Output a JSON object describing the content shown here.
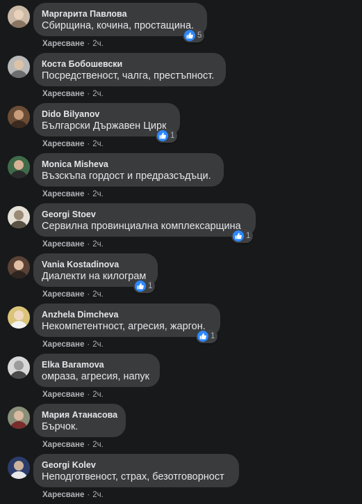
{
  "colors": {
    "background": "#18191a",
    "bubble": "#3a3b3c",
    "text": "#e4e6eb",
    "secondary_text": "#b0b3b8",
    "like_blue": "#2d88ff"
  },
  "comments": [
    {
      "author": "Маргарита Павлова",
      "text": "Сбирщина, кочина, простащина.",
      "like_label": "Харесване",
      "time": "2ч.",
      "reactions": "5",
      "reaction_icon": "like-icon"
    },
    {
      "author": "Коста Бобошевски",
      "text": "Посредственост, чалга, престъпност.",
      "like_label": "Харесване",
      "time": "2ч."
    },
    {
      "author": "Dido Bilyanov",
      "text": "Български Държавен Цирк",
      "like_label": "Харесване",
      "time": "2ч.",
      "reactions": "1",
      "reaction_icon": "like-icon"
    },
    {
      "author": "Monica Misheva",
      "text": "Възскъпа гордост и предразсъдъци.",
      "like_label": "Харесване",
      "time": "2ч."
    },
    {
      "author": "Georgi Stoev",
      "text": "Сервилна провинциална комплексарщина",
      "like_label": "Харесване",
      "time": "2ч.",
      "reactions": "1",
      "reaction_icon": "like-icon"
    },
    {
      "author": "Vania Kostadinova",
      "text": "Диалекти на килограм",
      "like_label": "Харесване",
      "time": "2ч.",
      "reactions": "1",
      "reaction_icon": "like-icon"
    },
    {
      "author": "Anzhela Dimcheva",
      "text": "Некомпетентност, агресия, жаргон.",
      "like_label": "Харесване",
      "time": "2ч.",
      "reactions": "1",
      "reaction_icon": "like-icon"
    },
    {
      "author": "Elka Baramova",
      "text": "омраза, агресия, напук",
      "like_label": "Харесване",
      "time": "2ч."
    },
    {
      "author": "Мария Атанасова",
      "text": "Бърчок.",
      "like_label": "Харесване",
      "time": "2ч."
    },
    {
      "author": "Georgi Kolev",
      "text": "Неподготвеност, страх, безотговорност",
      "like_label": "Харесване",
      "time": "2ч."
    }
  ]
}
